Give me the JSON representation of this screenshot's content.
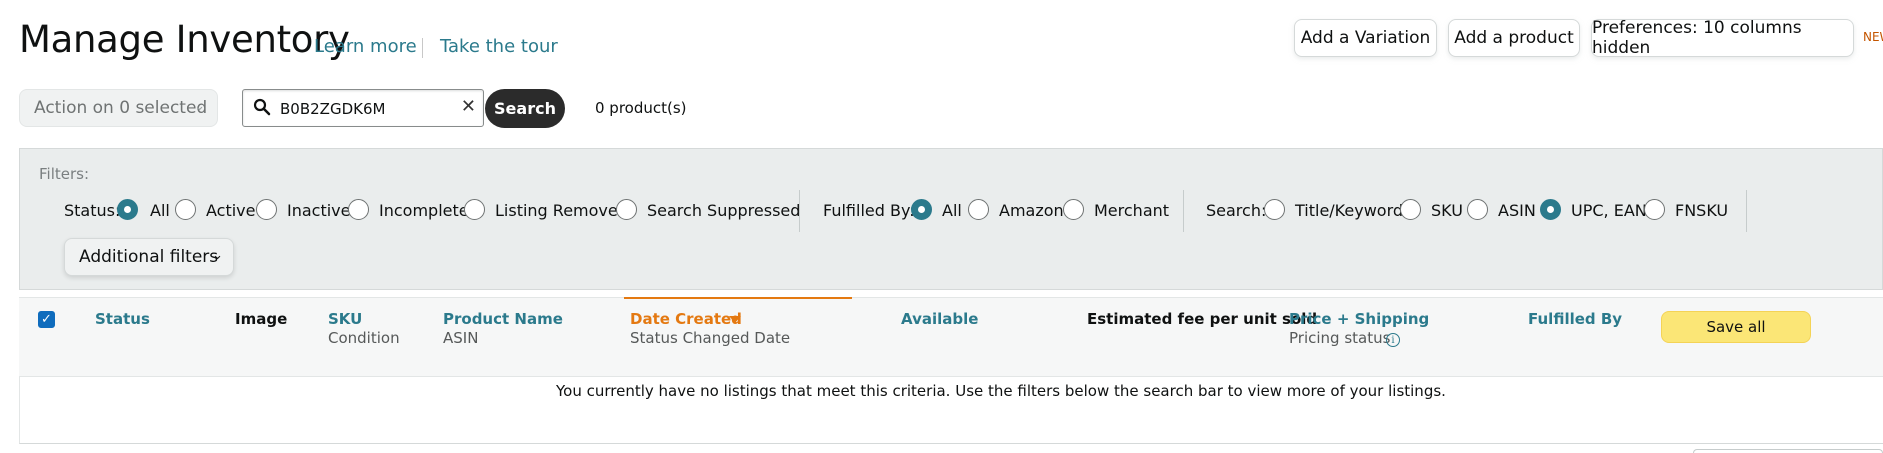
{
  "header": {
    "title": "Manage Inventory",
    "learn_more": "Learn more",
    "take_tour": "Take the tour",
    "add_variation": "Add a Variation",
    "add_product": "Add a product",
    "preferences": "Preferences: 10 columns hidden",
    "new_badge": "NEW"
  },
  "toolbar": {
    "action_select": "Action on 0 selected",
    "search_value": "B0B2ZGDK6M",
    "search_button": "Search",
    "product_count": "0 product(s)"
  },
  "filters": {
    "label": "Filters:",
    "status": {
      "label": "Status:",
      "options": [
        "All",
        "Active",
        "Inactive",
        "Incomplete",
        "Listing Removed",
        "Search Suppressed"
      ],
      "selected": "All"
    },
    "fulfilled_by": {
      "label": "Fulfilled By:",
      "options": [
        "All",
        "Amazon",
        "Merchant"
      ],
      "selected": "All"
    },
    "search": {
      "label": "Search:",
      "options": [
        "Title/Keyword",
        "SKU",
        "ASIN",
        "UPC, EAN",
        "FNSKU"
      ],
      "selected": "UPC, EAN"
    },
    "additional_filters": "Additional filters"
  },
  "table": {
    "columns": [
      {
        "label": "Status",
        "sub": ""
      },
      {
        "label": "Image",
        "sub": ""
      },
      {
        "label": "SKU",
        "sub": "Condition"
      },
      {
        "label": "Product Name",
        "sub": "ASIN"
      },
      {
        "label": "Date Created",
        "sub": "Status Changed Date"
      },
      {
        "label": "Available",
        "sub": ""
      },
      {
        "label": "Estimated fee per unit sold",
        "sub": ""
      },
      {
        "label": "Price + Shipping",
        "sub": "Pricing status"
      },
      {
        "label": "Fulfilled By",
        "sub": ""
      }
    ],
    "save_all": "Save all",
    "empty_message": "You currently have no listings that meet this criteria. Use the filters below the search bar to view more of your listings."
  },
  "colors": {
    "link": "#2b7a8c",
    "active_sort": "#e47911",
    "save_button": "#fbe676",
    "search_button": "#2b2b2b"
  }
}
